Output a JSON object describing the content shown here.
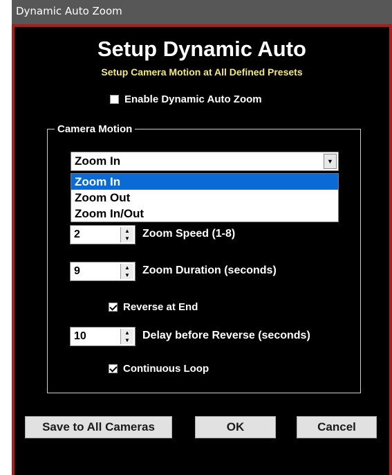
{
  "window": {
    "title": "Dynamic Auto Zoom"
  },
  "header": {
    "title": "Setup Dynamic Auto",
    "subtitle": "Setup Camera Motion at All Defined Presets"
  },
  "enable": {
    "label": "Enable Dynamic Auto Zoom",
    "checked": false
  },
  "camera_motion": {
    "group_label": "Camera Motion",
    "mode_select": {
      "value": "Zoom In",
      "options": [
        "Zoom In",
        "Zoom Out",
        "Zoom In/Out"
      ],
      "highlighted": "Zoom In"
    },
    "zoom_speed": {
      "value": "2",
      "label": "Zoom Speed (1-8)"
    },
    "zoom_duration": {
      "value": "9",
      "label": "Zoom Duration (seconds)"
    },
    "reverse_at_end": {
      "label": "Reverse at End",
      "checked": true
    },
    "delay_before_reverse": {
      "value": "10",
      "label": "Delay before Reverse (seconds)"
    },
    "continuous_loop": {
      "label": "Continuous Loop",
      "checked": true
    }
  },
  "buttons": {
    "save_all": "Save to All Cameras",
    "ok": "OK",
    "cancel": "Cancel"
  },
  "colors": {
    "background": "#000000",
    "border": "#b11a1a",
    "subtitle": "#f2e97a",
    "highlight": "#0a6bd6",
    "titlebar": "#575757"
  },
  "icons": {
    "dropdown": "chevron-down-icon",
    "spinner": "up-down-arrows-icon",
    "checkbox": "checkmark-icon"
  }
}
